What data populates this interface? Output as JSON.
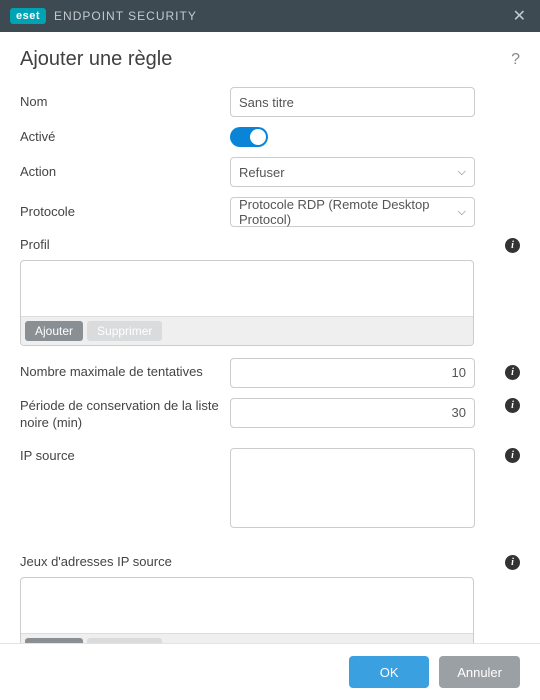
{
  "titlebar": {
    "brand": "eset",
    "product": "ENDPOINT SECURITY"
  },
  "header": {
    "title": "Ajouter une règle"
  },
  "form": {
    "name_label": "Nom",
    "name_value": "Sans titre",
    "enabled_label": "Activé",
    "action_label": "Action",
    "action_value": "Refuser",
    "protocol_label": "Protocole",
    "protocol_value": "Protocole RDP (Remote Desktop Protocol)",
    "profile_label": "Profil",
    "max_attempts_label": "Nombre maximale de tentatives",
    "max_attempts_value": "10",
    "blacklist_period_label": "Période de conservation de la liste noire (min)",
    "blacklist_period_value": "30",
    "source_ip_label": "IP source",
    "source_ip_sets_label": "Jeux d'adresses IP source"
  },
  "buttons": {
    "add": "Ajouter",
    "delete": "Supprimer",
    "ok": "OK",
    "cancel": "Annuler"
  }
}
